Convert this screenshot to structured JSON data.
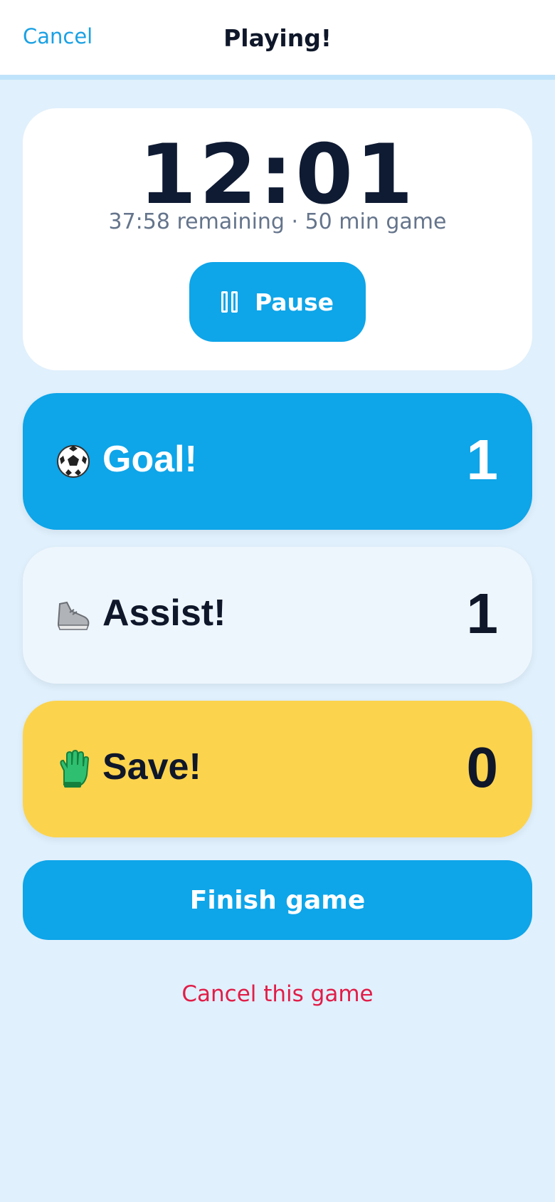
{
  "nav": {
    "cancel_label": "Cancel",
    "title": "Playing!"
  },
  "timer": {
    "elapsed": "12:01",
    "subtitle": "37:58 remaining · 50 min game",
    "pause_label": "Pause"
  },
  "stats": {
    "goal": {
      "icon": "soccer-ball-icon",
      "label": "Goal!",
      "count": "1"
    },
    "assist": {
      "icon": "shoe-icon",
      "label": "Assist!",
      "count": "1"
    },
    "save": {
      "icon": "goalkeeper-glove-icon",
      "label": "Save!",
      "count": "0"
    }
  },
  "actions": {
    "finish_label": "Finish game",
    "cancel_game_label": "Cancel this game"
  },
  "colors": {
    "accent": "#0ea5e9",
    "save_yellow": "#fcd34d",
    "danger": "#e11d48",
    "background": "#e0f0fc"
  }
}
